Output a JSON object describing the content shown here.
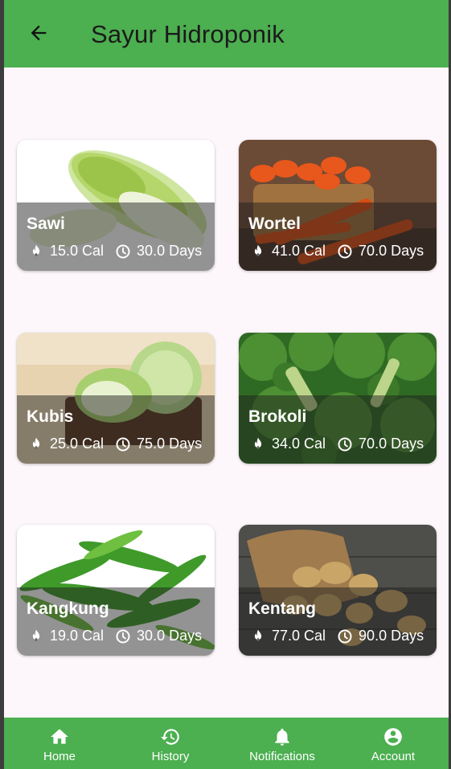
{
  "app_bar": {
    "title": "Sayur Hidroponik",
    "back_icon": "arrow-back-icon",
    "color": "#4caf50"
  },
  "vegetables": [
    {
      "name": "Sawi",
      "calories": "15.0 Cal",
      "duration": "30.0 Days"
    },
    {
      "name": "Wortel",
      "calories": "41.0 Cal",
      "duration": "70.0 Days"
    },
    {
      "name": "Kubis",
      "calories": "25.0 Cal",
      "duration": "75.0 Days"
    },
    {
      "name": "Brokoli",
      "calories": "34.0 Cal",
      "duration": "70.0 Days"
    },
    {
      "name": "Kangkung",
      "calories": "19.0 Cal",
      "duration": "30.0 Days"
    },
    {
      "name": "Kentang",
      "calories": "77.0 Cal",
      "duration": "90.0 Days"
    }
  ],
  "icons": {
    "calories": "fire-icon",
    "duration": "clock-icon"
  },
  "bottom_nav": {
    "items": [
      {
        "label": "Home",
        "icon": "home-icon"
      },
      {
        "label": "History",
        "icon": "history-icon"
      },
      {
        "label": "Notifications",
        "icon": "bell-icon"
      },
      {
        "label": "Account",
        "icon": "account-icon"
      }
    ]
  }
}
